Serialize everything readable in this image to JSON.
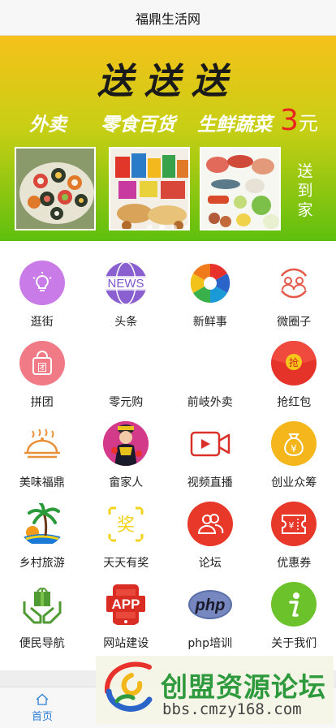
{
  "header": {
    "title": "福鼎生活网"
  },
  "banner": {
    "headline": "送送送",
    "items": [
      "外卖",
      "零食百货",
      "生鲜蔬菜"
    ],
    "price_number": "3",
    "price_unit": "元",
    "side_text": "送到家",
    "slide_count": 4,
    "active_slide": 2
  },
  "grid": {
    "rows": [
      [
        {
          "label": "逛街",
          "icon": "lightbulb-icon",
          "color": "#c97be8"
        },
        {
          "label": "头条",
          "icon": "news-icon",
          "color": "#7b55c9"
        },
        {
          "label": "新鲜事",
          "icon": "aperture-icon",
          "color": "#e53a2f"
        },
        {
          "label": "微圈子",
          "icon": "people-circle-icon",
          "color": "#e55a4a"
        }
      ],
      [
        {
          "label": "拼团",
          "icon": "shopping-bag-icon",
          "color": "#f07a86"
        },
        {
          "label": "零元购",
          "icon": "blank-icon",
          "color": "#ffffff"
        },
        {
          "label": "前岐外卖",
          "icon": "blank-icon",
          "color": "#ffffff"
        },
        {
          "label": "抢红包",
          "icon": "red-envelope-icon",
          "color": "#e5332a"
        }
      ],
      [
        {
          "label": "美味福鼎",
          "icon": "food-cloche-icon",
          "color": "#e8913a"
        },
        {
          "label": "畲家人",
          "icon": "she-person-photo-icon",
          "color": "#d53a8a"
        },
        {
          "label": "视频直播",
          "icon": "video-camera-icon",
          "color": "#d9302a"
        },
        {
          "label": "创业众筹",
          "icon": "money-bag-icon",
          "color": "#f4b61a"
        }
      ],
      [
        {
          "label": "乡村旅游",
          "icon": "palm-beach-icon",
          "color": "#2a9a5a"
        },
        {
          "label": "天天有奖",
          "icon": "prize-icon",
          "color": "#f2d21a"
        },
        {
          "label": "论坛",
          "icon": "forum-people-icon",
          "color": "#e8382a"
        },
        {
          "label": "优惠券",
          "icon": "coupon-icon",
          "color": "#e8382a"
        }
      ],
      [
        {
          "label": "便民导航",
          "icon": "hands-gift-icon",
          "color": "#4f9a32"
        },
        {
          "label": "网站建设",
          "icon": "app-phone-icon",
          "color": "#d92c22"
        },
        {
          "label": "php培训",
          "icon": "php-logo-icon",
          "color": "#5a6fa8"
        },
        {
          "label": "关于我们",
          "icon": "info-icon",
          "color": "#6cc22a"
        }
      ]
    ]
  },
  "tabbar": {
    "home_label": "首页"
  },
  "watermark": {
    "title": "创盟资源论坛",
    "url": "bbs.cmzy168.com"
  }
}
